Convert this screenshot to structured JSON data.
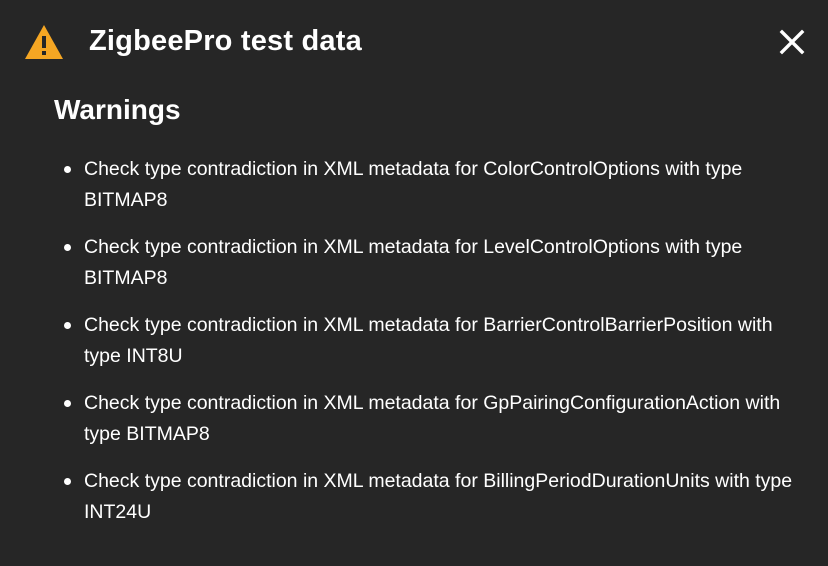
{
  "dialog": {
    "title": "ZigbeePro test data",
    "icons": {
      "warning": "warning-triangle-icon",
      "close": "close-x-icon"
    },
    "colors": {
      "background": "#262626",
      "warning_icon": "#f5a623",
      "text": "#ffffff"
    }
  },
  "warnings": {
    "heading": "Warnings",
    "items": [
      "Check type contradiction in XML metadata for ColorControlOptions with type BITMAP8",
      "Check type contradiction in XML metadata for LevelControlOptions with type BITMAP8",
      "Check type contradiction in XML metadata for BarrierControlBarrierPosition with type INT8U",
      "Check type contradiction in XML metadata for GpPairingConfigurationAction with type BITMAP8",
      "Check type contradiction in XML metadata for BillingPeriodDurationUnits with type INT24U"
    ]
  }
}
